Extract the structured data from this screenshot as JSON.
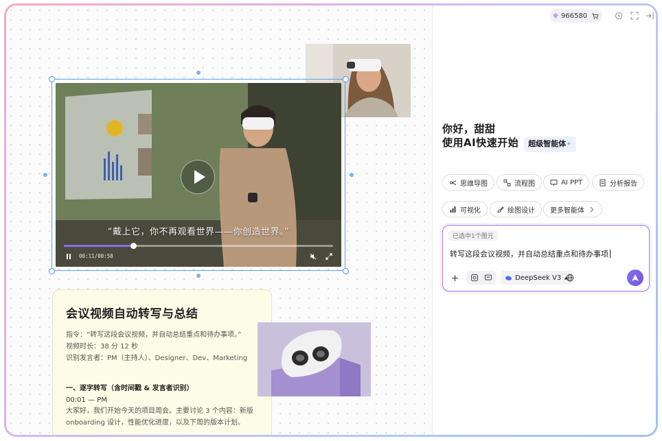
{
  "header": {
    "credits": "966580",
    "icons": [
      "gem-icon",
      "cart-icon",
      "history-icon",
      "fullscreen-icon",
      "collapse-panel-icon"
    ]
  },
  "video": {
    "subtitle": "“戴上它，你不再观看世界——你创造世界。”",
    "time": "00:11/00:58",
    "progress": 0.26
  },
  "document": {
    "title": "会议视频自动转写与总结",
    "instruction": "指令：“转写这段会议视频，并自动总结重点和待办事项。”",
    "duration": "视频时长：38 分 12 秒",
    "speakers": "识别发言者：PM（主持人）、Designer、Dev、Marketing",
    "section_title": "一、逐字转写（含时间戳 & 发言者识别）",
    "timestamp": "00:01 — PM",
    "paragraph_line1": "大家好，我们开始今天的项目周会。主要讨论 3 个内容：新版",
    "paragraph_line2": "onboarding 设计，性能优化进度，以及下周的版本计划。"
  },
  "assistant": {
    "greeting_line1": "你好，甜甜",
    "greeting_line2": "使用AI快速开始",
    "badge": "超级智能体",
    "chips": [
      {
        "label": "思维导图",
        "icon": "mindmap-icon"
      },
      {
        "label": "流程图",
        "icon": "flowchart-icon"
      },
      {
        "label": "AI PPT",
        "icon": "presentation-icon"
      },
      {
        "label": "分析报告",
        "icon": "report-icon"
      },
      {
        "label": "可视化",
        "icon": "chart-icon"
      },
      {
        "label": "绘图设计",
        "icon": "brush-icon"
      },
      {
        "label": "更多智能体",
        "icon": "chevron-right-icon"
      }
    ],
    "selection_tag": "已选中1个图元",
    "prompt": "转写这段会议视频，并自动总结重点和待办事项",
    "model": "DeepSeek V3"
  },
  "colors": {
    "accent": "#8a6cf0",
    "selection": "#4a95e6",
    "doc_bg": "#fdfce6"
  }
}
